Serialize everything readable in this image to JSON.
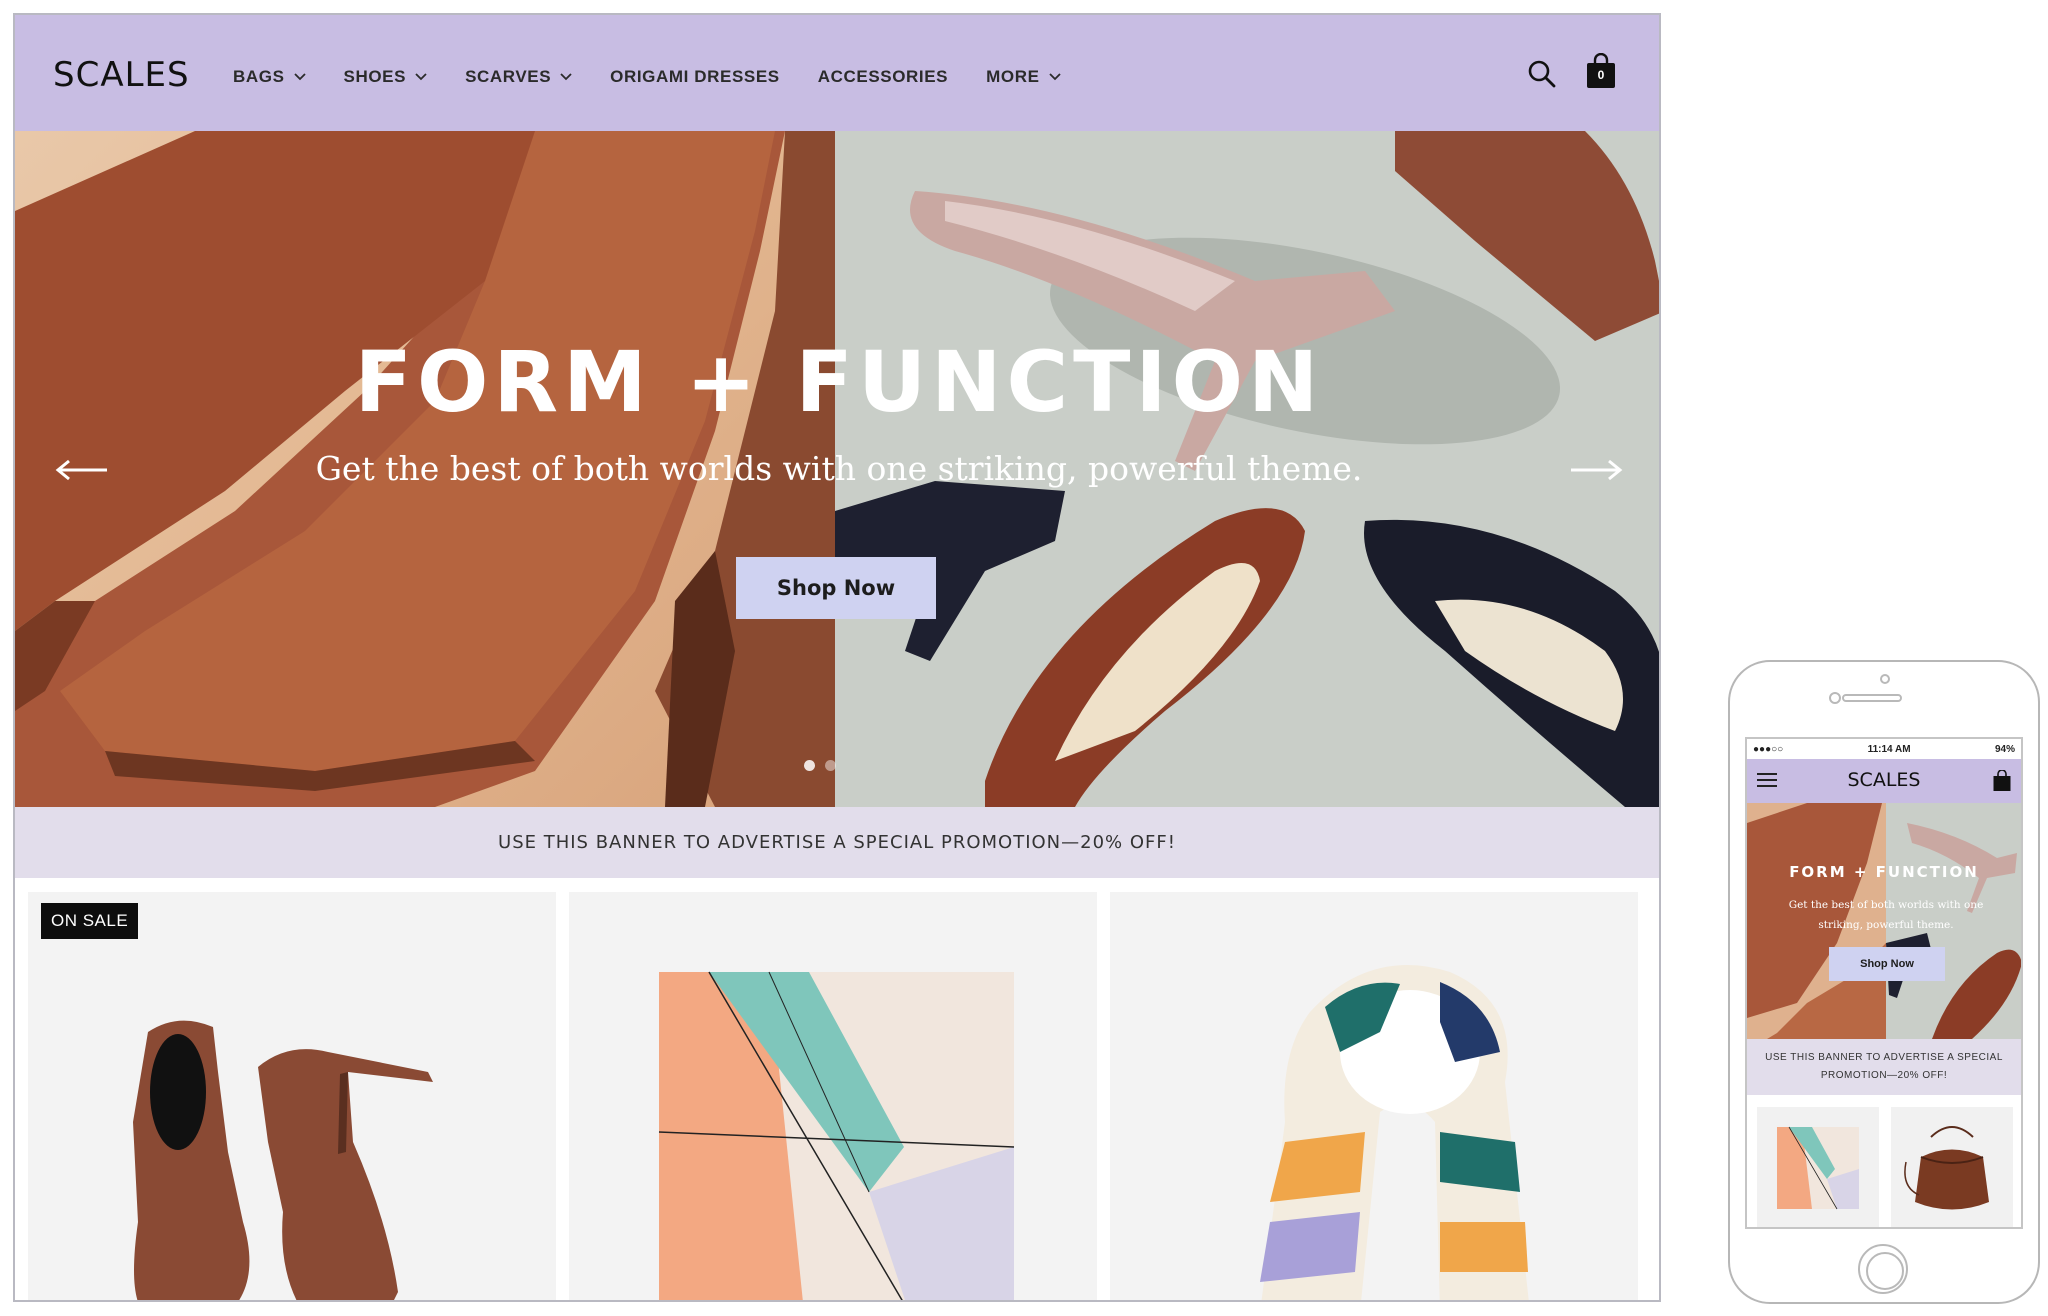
{
  "desktop": {
    "logo": "SCALES",
    "nav": [
      {
        "label": "BAGS",
        "has_dropdown": true
      },
      {
        "label": "SHOES",
        "has_dropdown": true
      },
      {
        "label": "SCARVES",
        "has_dropdown": true
      },
      {
        "label": "ORIGAMI DRESSES",
        "has_dropdown": false
      },
      {
        "label": "ACCESSORIES",
        "has_dropdown": false
      },
      {
        "label": "MORE",
        "has_dropdown": true
      }
    ],
    "cart_count": "0",
    "hero": {
      "title": "FORM + FUNCTION",
      "subtitle": "Get the best of both worlds with one striking, powerful theme.",
      "button": "Shop Now",
      "slide_count": 2,
      "active_slide": 1
    },
    "promo": "USE THIS BANNER TO ADVERTISE A SPECIAL PROMOTION—20% OFF!",
    "products": [
      {
        "image": "brown-suede-ankle-boots",
        "badge": "ON SALE"
      },
      {
        "image": "geometric-silk-scarf",
        "badge": ""
      },
      {
        "image": "watercolor-stripe-scarf",
        "badge": ""
      }
    ]
  },
  "phone": {
    "status": {
      "carrier": "●●●○○",
      "time": "11:14 AM",
      "battery": "94%"
    },
    "logo": "SCALES",
    "cart_count": "0",
    "hero": {
      "title": "FORM + FUNCTION",
      "subtitle": "Get the best of both worlds with one striking, powerful theme.",
      "button": "Shop Now"
    },
    "promo": "USE THIS BANNER TO ADVERTISE A SPECIAL PROMOTION—20% OFF!",
    "products": [
      {
        "image": "geometric-silk-scarf"
      },
      {
        "image": "brown-leather-bucket-bag"
      }
    ]
  },
  "colors": {
    "header_bg": "#c8bde3",
    "promo_bg": "#e2ddeb",
    "button_bg": "#cfd2f1",
    "badge_bg": "#0d0d0d"
  }
}
